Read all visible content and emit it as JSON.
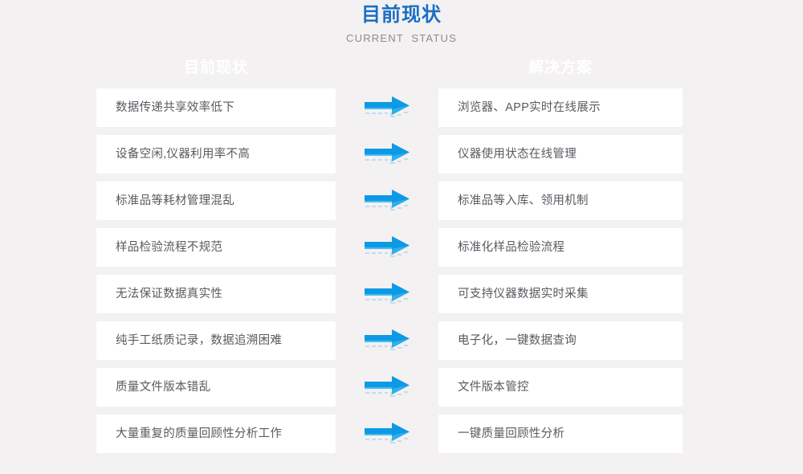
{
  "header": {
    "title": "目前现状",
    "subtitle": "CURRENT  STATUS",
    "title_color": "#1a6fc4",
    "subtitle_color": "#8a8a90"
  },
  "columns": {
    "left_heading": "目前现状",
    "right_heading": "解决方案",
    "heading_color": "#ffffff"
  },
  "arrow": {
    "icon": "arrow-right-icon",
    "color": "#0d9ae5",
    "highlight_color": "#54c3f1"
  },
  "background_color": "#f4f1f2",
  "card_color": "#ffffff",
  "rows": [
    {
      "problem": "数据传递共享效率低下",
      "solution": "浏览器、APP实时在线展示"
    },
    {
      "problem": "设备空闲,仪器利用率不高",
      "solution": "仪器使用状态在线管理"
    },
    {
      "problem": "标准品等耗材管理混乱",
      "solution": "标准品等入库、领用机制"
    },
    {
      "problem": "样品检验流程不规范",
      "solution": "标准化样品检验流程"
    },
    {
      "problem": "无法保证数据真实性",
      "solution": "可支持仪器数据实时采集"
    },
    {
      "problem": "纯手工纸质记录，数据追溯困难",
      "solution": "电子化，一键数据查询"
    },
    {
      "problem": "质量文件版本错乱",
      "solution": "文件版本管控"
    },
    {
      "problem": "大量重复的质量回顾性分析工作",
      "solution": "一键质量回顾性分析"
    }
  ]
}
